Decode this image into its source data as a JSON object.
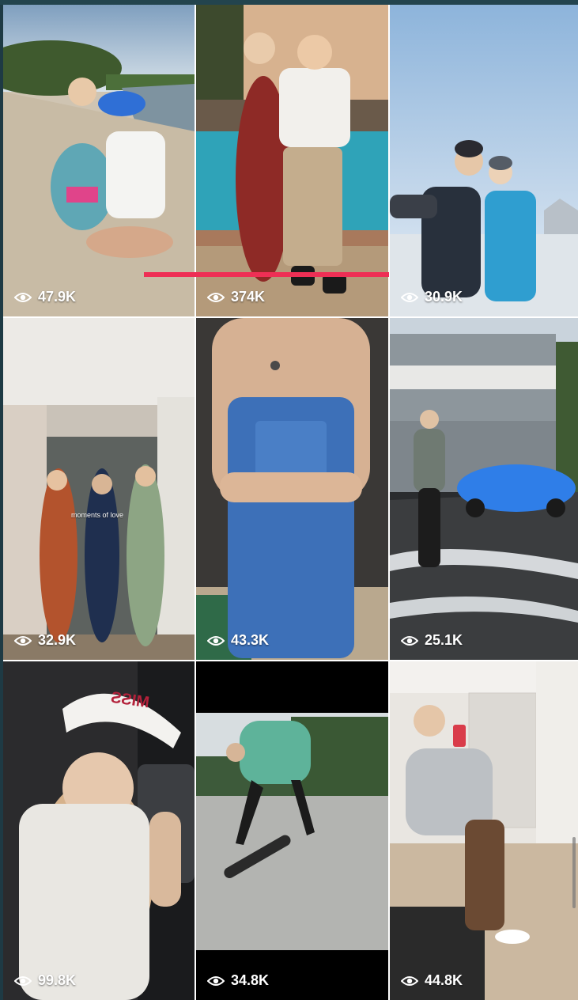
{
  "grid": {
    "tiles": [
      {
        "views": "47.9K"
      },
      {
        "views": "374K"
      },
      {
        "views": "30.9K",
        "progress": 0.62
      },
      {
        "views": "32.9K",
        "caption": "moments of love"
      },
      {
        "views": "43.3K"
      },
      {
        "views": "25.1K"
      },
      {
        "views": "99.8K",
        "cap_text": "MISS"
      },
      {
        "views": "34.8K"
      },
      {
        "views": "44.8K"
      }
    ]
  },
  "icons": {
    "view_count": "eye-icon"
  },
  "colors": {
    "background": "#1e3a44",
    "progress_bar": "#ee2f55",
    "view_text": "#ffffff"
  }
}
